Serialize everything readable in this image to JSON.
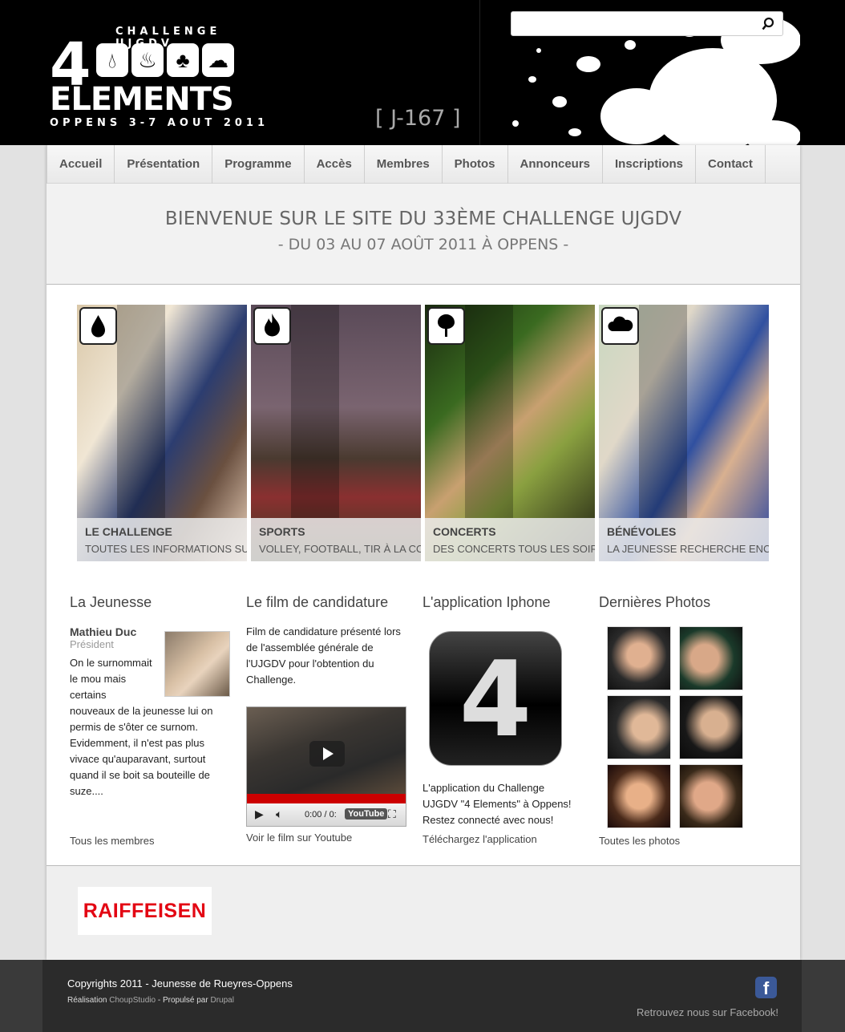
{
  "header": {
    "logo": {
      "top_text": "CHALLENGE UJGDV",
      "big_number": "4",
      "main_text": "ELEMENTS",
      "bottom_text": "OPPENS 3-7 AOUT 2011"
    },
    "countdown": "[ J-167 ]",
    "search": {
      "placeholder": "",
      "value": ""
    }
  },
  "nav": {
    "items": [
      "Accueil",
      "Présentation",
      "Programme",
      "Accès",
      "Membres",
      "Photos",
      "Annonceurs",
      "Inscriptions",
      "Contact"
    ]
  },
  "welcome": {
    "title": "BIENVENUE SUR LE SITE DU 33ÈME CHALLENGE UJGDV",
    "subtitle": "- DU 03 AU 07 AOÛT 2011 À OPPENS -"
  },
  "cards": [
    {
      "icon": "water-drop-icon",
      "title": "LE CHALLENGE",
      "subtitle": "TOUTES LES INFORMATIONS SUR"
    },
    {
      "icon": "fire-icon",
      "title": "SPORTS",
      "subtitle": "VOLLEY, FOOTBALL, TIR À LA CO"
    },
    {
      "icon": "tree-icon",
      "title": "CONCERTS",
      "subtitle": "DES CONCERTS TOUS LES SOIRS"
    },
    {
      "icon": "cloud-icon",
      "title": "BÉNÉVOLES",
      "subtitle": "LA JEUNESSE RECHERCHE ENCO"
    }
  ],
  "jeunesse": {
    "heading": "La Jeunesse",
    "member_name": "Mathieu Duc",
    "member_role": "Président",
    "text_a": "On le surnommait le mou mais certains",
    "text_b": "nouveaux de la jeunesse lui on permis de s'ôter ce surnom. Evidemment, il n'est pas plus vivace qu'auparavant, surtout quand il se boit sa bouteille de suze....",
    "link": "Tous les membres"
  },
  "film": {
    "heading": "Le film de candidature",
    "text": "Film de candidature présenté lors de l'assemblée générale de l'UJGDV pour l'obtention du Challenge.",
    "time": "0:00 / 0:",
    "yt_label": "YouTube",
    "link": "Voir le film sur Youtube"
  },
  "app": {
    "heading": "L'application Iphone",
    "icon_text": "4",
    "text": "L'application du Challenge UJGDV \"4 Elements\" à Oppens! Restez connecté avec nous!",
    "link": "Téléchargez l'application"
  },
  "photos": {
    "heading": "Dernières Photos",
    "link": "Toutes les photos"
  },
  "sponsor": {
    "name": "RAIFFEISEN"
  },
  "footer": {
    "copyright": "Copyrights 2011 - Jeunesse de Rueyres-Oppens",
    "realisation_label": "Réalisation",
    "realisation_link": "ChoupStudio",
    "powered_label": "- Propulsé par",
    "powered_link": "Drupal",
    "facebook_text": "Retrouvez nous sur Facebook!",
    "facebook_icon": "f"
  },
  "colors": {
    "header_bg": "#000000",
    "nav_text": "#555555",
    "raiffeisen_red": "#e30613",
    "facebook_blue": "#3b5998",
    "footer_bg": "#2b2b2b"
  }
}
